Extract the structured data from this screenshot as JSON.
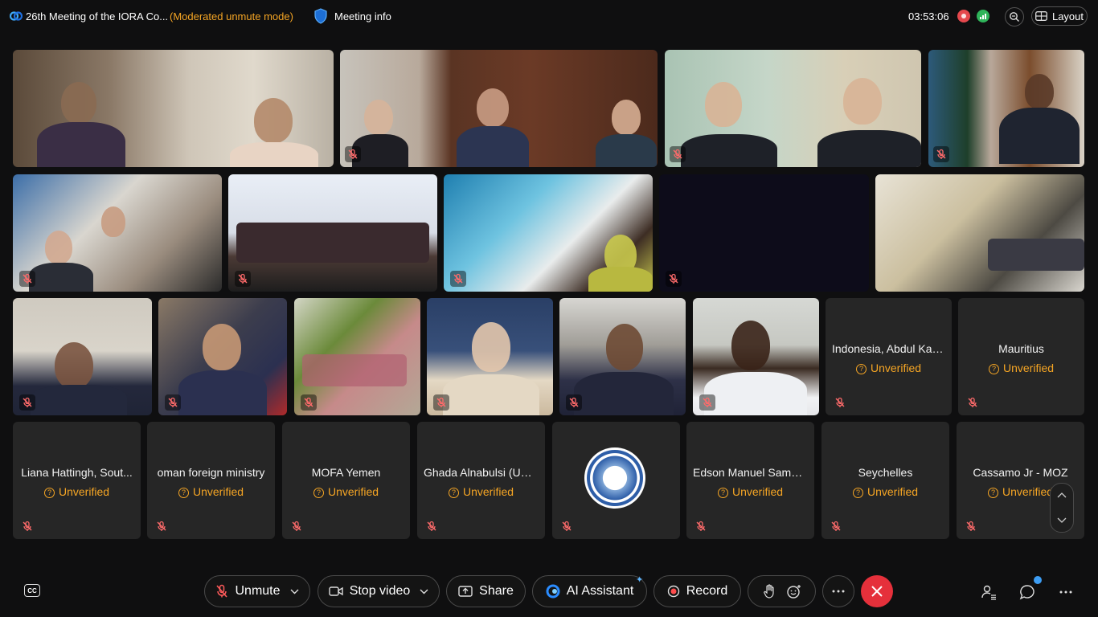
{
  "header": {
    "meeting_title": "26th Meeting of the IORA Co...",
    "mode": "(Moderated unmute mode)",
    "meeting_info": "Meeting info",
    "elapsed_time": "03:53:06",
    "layout_label": "Layout"
  },
  "participants": [
    {
      "name": "Indonesia, Abdul Kad...",
      "status": "Unverified"
    },
    {
      "name": "Mauritius",
      "status": "Unverified"
    },
    {
      "name": "Liana Hattingh, Sout...",
      "status": "Unverified"
    },
    {
      "name": "oman foreign ministry",
      "status": "Unverified"
    },
    {
      "name": "MOFA Yemen",
      "status": "Unverified"
    },
    {
      "name": "Ghada Alnabulsi (UAE)",
      "status": "Unverified"
    },
    {
      "name": "Edson Manuel Samso...",
      "status": "Unverified"
    },
    {
      "name": "Seychelles",
      "status": "Unverified"
    },
    {
      "name": "Cassamo Jr - MOZ",
      "status": "Unverified"
    }
  ],
  "controls": {
    "unmute": "Unmute",
    "stop_video": "Stop video",
    "share": "Share",
    "ai_assistant": "AI Assistant",
    "record": "Record",
    "cc": "CC"
  },
  "colors": {
    "accent_warning": "#f5a524",
    "end_call": "#e5303b",
    "tile_bg": "#262626"
  }
}
